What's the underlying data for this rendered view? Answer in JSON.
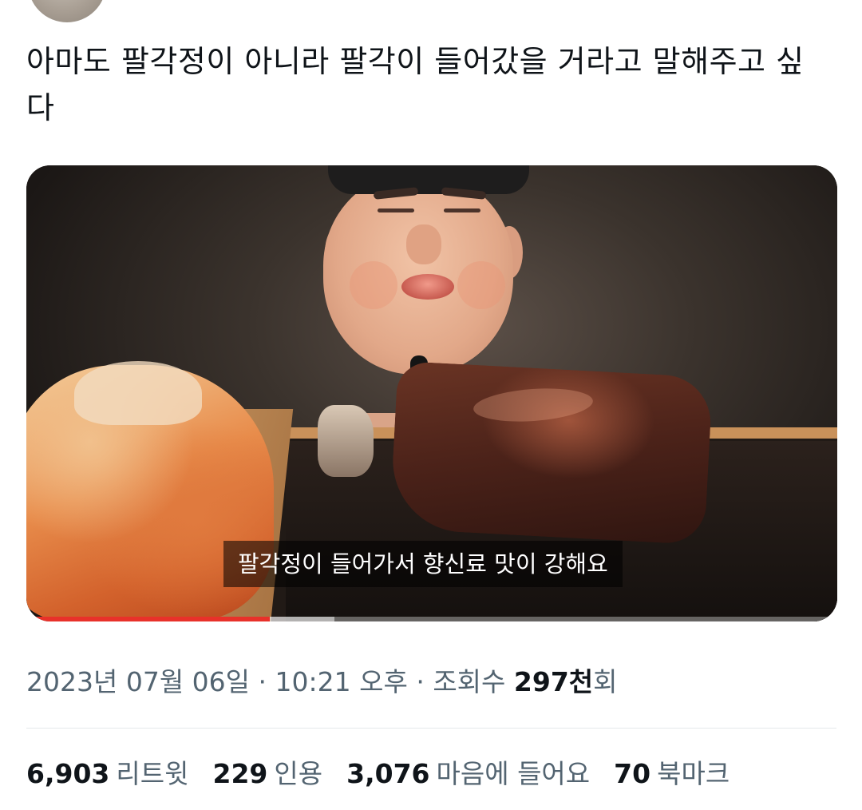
{
  "tweet": {
    "text": "아마도 팔각정이 아니라 팔각이 들어갔을 거라고 말해주고 싶다"
  },
  "media": {
    "subtitle": "팔각정이 들어가서 향신료 맛이 강해요",
    "progress_fraction": 0.3,
    "buffer_fraction": 0.38,
    "progress_color": "#e8312a"
  },
  "meta": {
    "date": "2023년 07월 06일",
    "sep1": " · ",
    "time": "10:21 오후",
    "sep2": " · ",
    "views_label": "조회수 ",
    "views_count": "297천",
    "views_suffix": "회"
  },
  "stats": [
    {
      "count": "6,903",
      "label": "리트윗"
    },
    {
      "count": "229",
      "label": "인용"
    },
    {
      "count": "3,076",
      "label": "마음에 들어요"
    },
    {
      "count": "70",
      "label": "북마크"
    }
  ],
  "colors": {
    "text_primary": "#0f1419",
    "text_secondary": "#536471",
    "divider": "#e4e8eb"
  }
}
